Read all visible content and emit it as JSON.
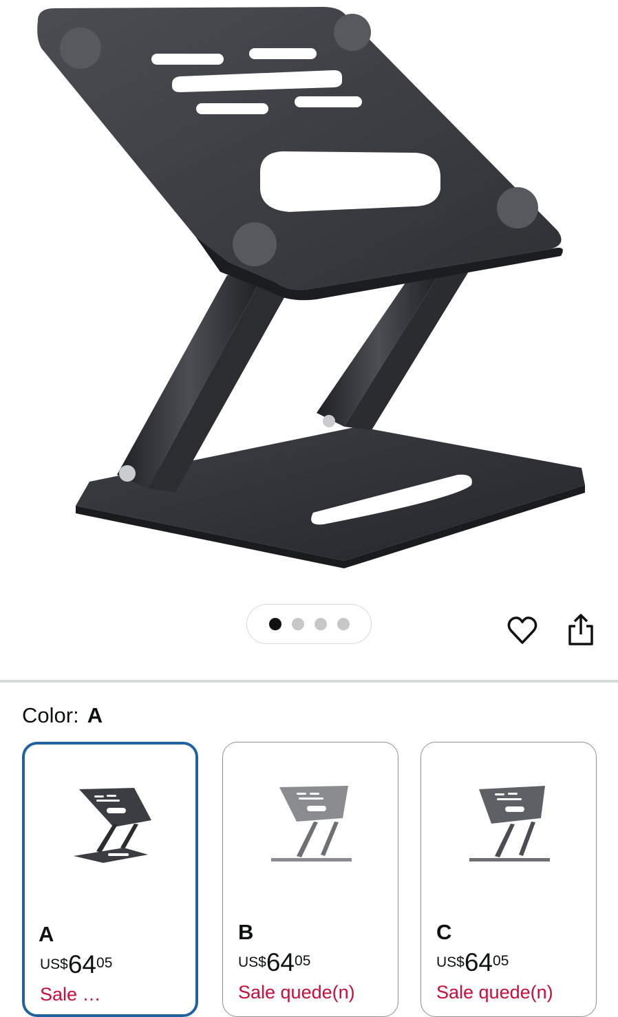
{
  "gallery": {
    "image_alt": "Black adjustable aluminum laptop stand",
    "dot_count": 4,
    "active_dot": 0
  },
  "actions": {
    "favorite_icon": "heart-icon",
    "share_icon": "share-icon"
  },
  "color_selector": {
    "label": "Color:",
    "selected_value": "A"
  },
  "swatches": [
    {
      "name": "A",
      "currency": "US$",
      "whole": "64",
      "fraction": "05",
      "sale_text": "Sale … ",
      "selected": true,
      "tone": "#3a3d41"
    },
    {
      "name": "B",
      "currency": "US$",
      "whole": "64",
      "fraction": "05",
      "sale_text": "Sale quede(n)",
      "selected": false,
      "tone": "#8a8c90"
    },
    {
      "name": "C",
      "currency": "US$",
      "whole": "64",
      "fraction": "05",
      "sale_text": "Sale quede(n)",
      "selected": false,
      "tone": "#5d6065"
    }
  ],
  "colors": {
    "selected_border": "#2162a1",
    "sale_red": "#cc0c39",
    "divider": "#d5dbdb"
  }
}
